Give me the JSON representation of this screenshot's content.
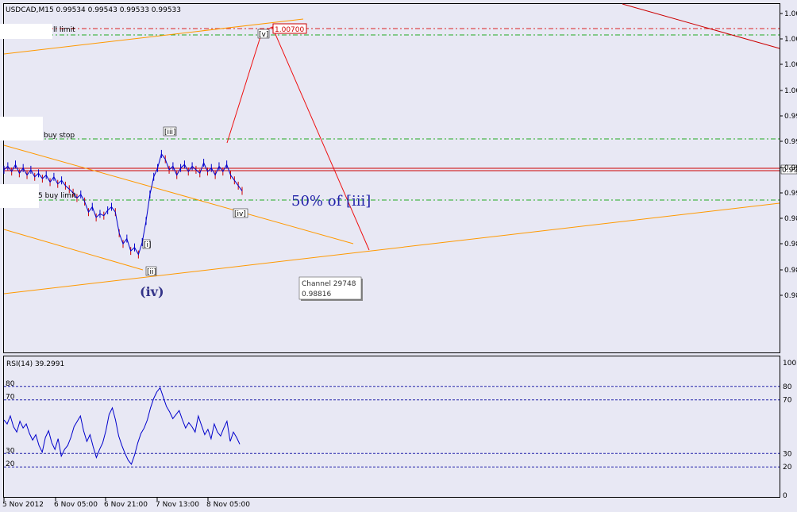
{
  "header": {
    "symbol_line": "USDCAD,M15  0.99534 0.99543 0.99533 0.99533"
  },
  "order_labels": {
    "sell_limit": "ll limit",
    "buy_stop": "buy stop",
    "buy_limit": "5 buy limit"
  },
  "price_tag": "1.00700",
  "price_axis_ticks": [
    "1.00",
    "1.00",
    "1.00",
    "1.00",
    "0.99",
    "0.99",
    "0.99",
    "0.99",
    "0.98",
    "0.98",
    "0.98",
    "0.98"
  ],
  "current_price_tag": "0.99",
  "wave_labels": {
    "iii": "[iii]",
    "v": "[v]",
    "iv_small": "[iv]",
    "i": "[i]",
    "ii": "[ii]",
    "iv": "(iv)"
  },
  "annotation": "50% of [iii]",
  "tooltip": {
    "line1": "Channel 29748",
    "line2": "0.98816"
  },
  "rsi": {
    "title": "RSI(14) 39.2991",
    "left_levels": [
      "80",
      "70",
      "30",
      "20"
    ],
    "right_ticks": [
      "100",
      "80",
      "70",
      "30",
      "20",
      "0"
    ]
  },
  "time_labels": [
    "5 Nov 2012",
    "6 Nov 05:00",
    "6 Nov 21:00",
    "7 Nov 13:00",
    "8 Nov 05:00"
  ],
  "colors": {
    "background": "#e8e8f4",
    "bull_candle": "#0000cc",
    "bear_candle": "#cc0000",
    "channel": "#ff9900",
    "wave_projection": "#ee1111",
    "sell_level": "#dd2222",
    "buy_level": "#22aa22",
    "rsi_line": "#0000cc",
    "rsi_levels": "#2222aa"
  },
  "chart_data": {
    "type": "line",
    "series": [
      {
        "values": [
          0.9929,
          0.9931,
          0.9928,
          0.9932,
          0.9927,
          0.993,
          0.9926,
          0.9929,
          0.9925,
          0.9927,
          0.9924,
          0.9926,
          0.9922,
          0.9925,
          0.9921,
          0.9923,
          0.992,
          0.9918,
          0.9916,
          0.9913,
          0.9915,
          0.9911,
          0.9905,
          0.9908,
          0.9902,
          0.9904,
          0.9903,
          0.9906,
          0.9908,
          0.9905,
          0.9893,
          0.9887,
          0.989,
          0.9883,
          0.9885,
          0.9881,
          0.9888,
          0.99,
          0.9915,
          0.9925,
          0.993,
          0.9938,
          0.9935,
          0.9929,
          0.9931,
          0.9926,
          0.993,
          0.9932,
          0.9928,
          0.9931,
          0.9929,
          0.9927,
          0.9933,
          0.9928,
          0.993,
          0.9926,
          0.9931,
          0.9928,
          0.9932,
          0.9926,
          0.9923,
          0.992,
          0.9917
        ]
      }
    ],
    "levels": {
      "sell_limit": 1.007,
      "buy_stop": 0.9944,
      "current": 0.99533,
      "buy_limit": 0.9894,
      "channel_point": 0.98816
    },
    "rsi": {
      "name": "RSI(14)",
      "ylim": [
        0,
        100
      ],
      "levels": [
        80,
        70,
        30,
        20
      ],
      "values": [
        55,
        52,
        58,
        50,
        46,
        54,
        49,
        52,
        45,
        40,
        44,
        36,
        31,
        42,
        47,
        38,
        33,
        41,
        28,
        33,
        36,
        42,
        50,
        54,
        58,
        47,
        39,
        44,
        35,
        27,
        33,
        38,
        47,
        59,
        64,
        55,
        43,
        36,
        30,
        25,
        22,
        29,
        38,
        45,
        49,
        55,
        64,
        71,
        76,
        79,
        72,
        65,
        61,
        56,
        59,
        62,
        55,
        49,
        53,
        50,
        46,
        58,
        51,
        44,
        48,
        41,
        52,
        46,
        43,
        49,
        54,
        39,
        46,
        42,
        37
      ]
    }
  }
}
